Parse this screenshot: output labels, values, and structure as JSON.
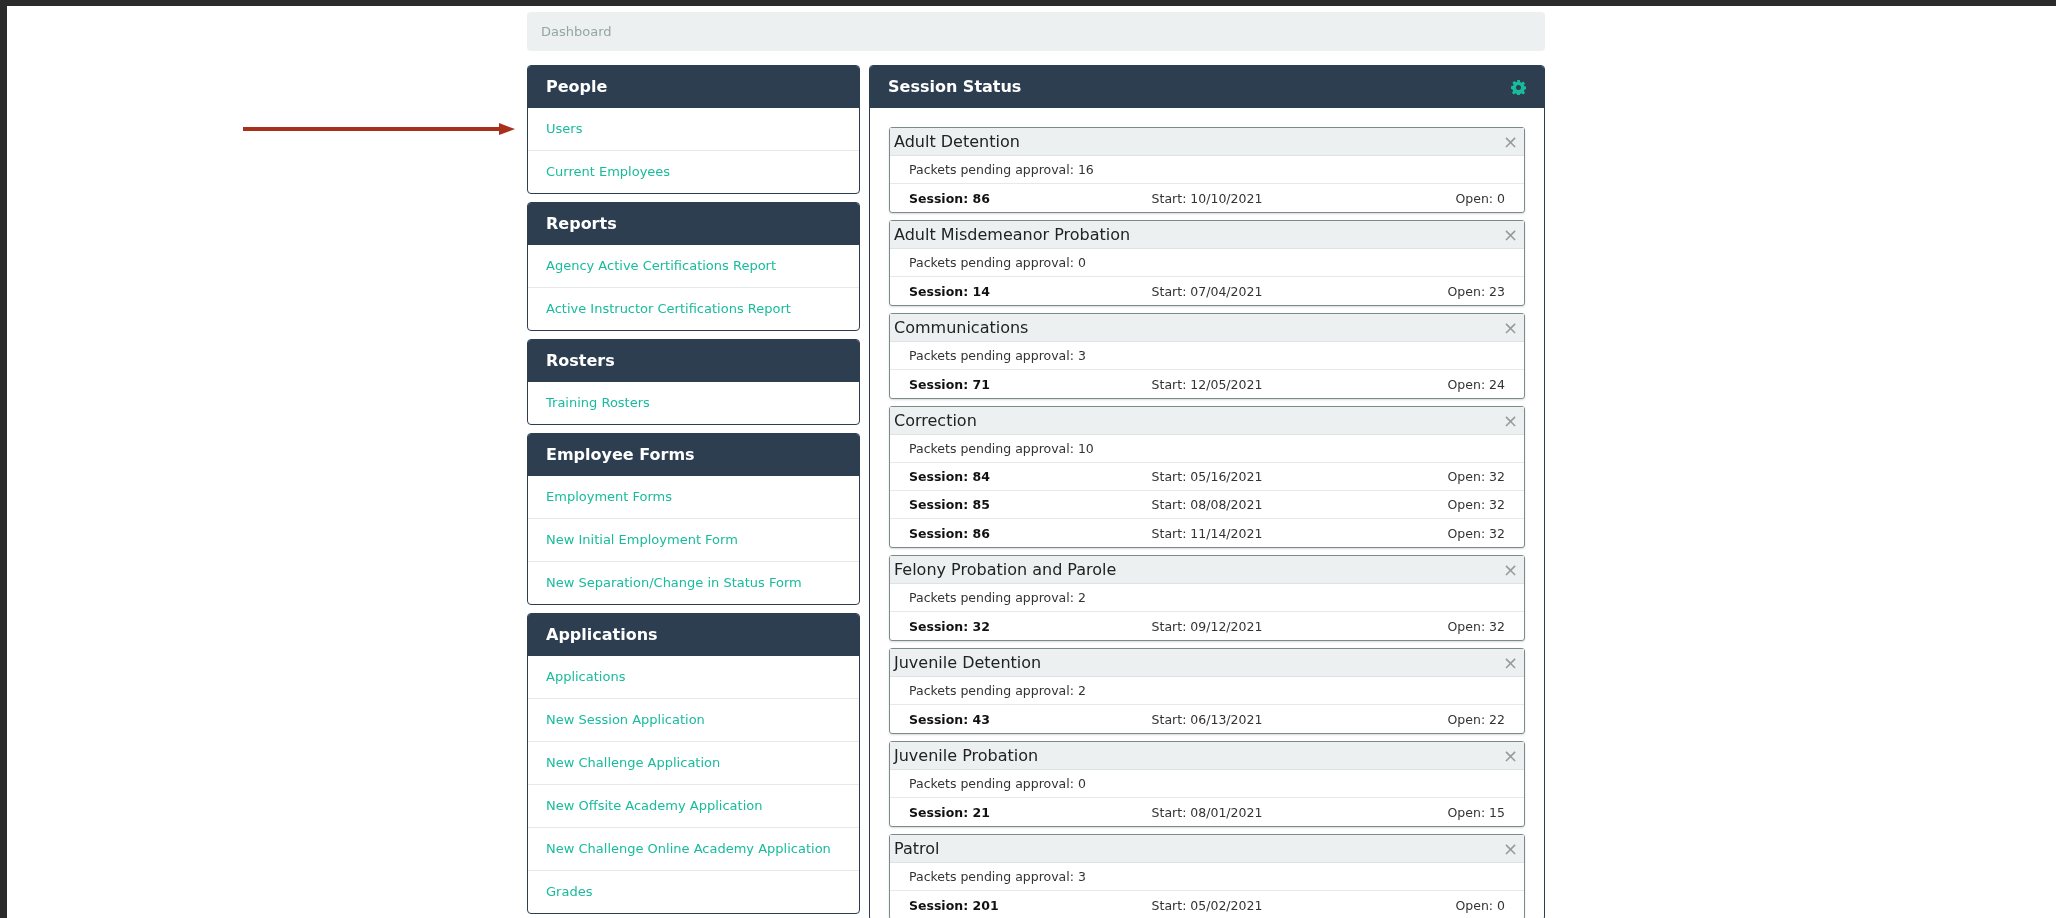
{
  "breadcrumb": "Dashboard",
  "sidebar": [
    {
      "title": "People",
      "items": [
        "Users",
        "Current Employees"
      ]
    },
    {
      "title": "Reports",
      "items": [
        "Agency Active Certifications Report",
        "Active Instructor Certifications Report"
      ]
    },
    {
      "title": "Rosters",
      "items": [
        "Training Rosters"
      ]
    },
    {
      "title": "Employee Forms",
      "items": [
        "Employment Forms",
        "New Initial Employment Form",
        "New Separation/Change in Status Form"
      ]
    },
    {
      "title": "Applications",
      "items": [
        "Applications",
        "New Session Application",
        "New Challenge Application",
        "New Offsite Academy Application",
        "New Challenge Online Academy Application",
        "Grades"
      ]
    }
  ],
  "session_status": {
    "title": "Session Status",
    "cards": [
      {
        "title": "Adult Detention",
        "close": "×",
        "pending": "Packets pending approval: 16",
        "sessions": [
          {
            "session": "Session: 86",
            "start": "Start: 10/10/2021",
            "open": "Open: 0"
          }
        ]
      },
      {
        "title": "Adult Misdemeanor Probation",
        "close": "×",
        "pending": "Packets pending approval: 0",
        "sessions": [
          {
            "session": "Session: 14",
            "start": "Start: 07/04/2021",
            "open": "Open: 23"
          }
        ]
      },
      {
        "title": "Communications",
        "close": "×",
        "pending": "Packets pending approval: 3",
        "sessions": [
          {
            "session": "Session: 71",
            "start": "Start: 12/05/2021",
            "open": "Open: 24"
          }
        ]
      },
      {
        "title": "Correction",
        "close": "×",
        "pending": "Packets pending approval: 10",
        "sessions": [
          {
            "session": "Session: 84",
            "start": "Start: 05/16/2021",
            "open": "Open: 32"
          },
          {
            "session": "Session: 85",
            "start": "Start: 08/08/2021",
            "open": "Open: 32"
          },
          {
            "session": "Session: 86",
            "start": "Start: 11/14/2021",
            "open": "Open: 32"
          }
        ]
      },
      {
        "title": "Felony Probation and Parole",
        "close": "×",
        "pending": "Packets pending approval: 2",
        "sessions": [
          {
            "session": "Session: 32",
            "start": "Start: 09/12/2021",
            "open": "Open: 32"
          }
        ]
      },
      {
        "title": "Juvenile Detention",
        "close": "×",
        "pending": "Packets pending approval: 2",
        "sessions": [
          {
            "session": "Session: 43",
            "start": "Start: 06/13/2021",
            "open": "Open: 22"
          }
        ]
      },
      {
        "title": "Juvenile Probation",
        "close": "×",
        "pending": "Packets pending approval: 0",
        "sessions": [
          {
            "session": "Session: 21",
            "start": "Start: 08/01/2021",
            "open": "Open: 15"
          }
        ]
      },
      {
        "title": "Patrol",
        "close": "×",
        "pending": "Packets pending approval: 3",
        "sessions": [
          {
            "session": "Session: 201",
            "start": "Start: 05/02/2021",
            "open": "Open: 0"
          }
        ]
      }
    ]
  }
}
